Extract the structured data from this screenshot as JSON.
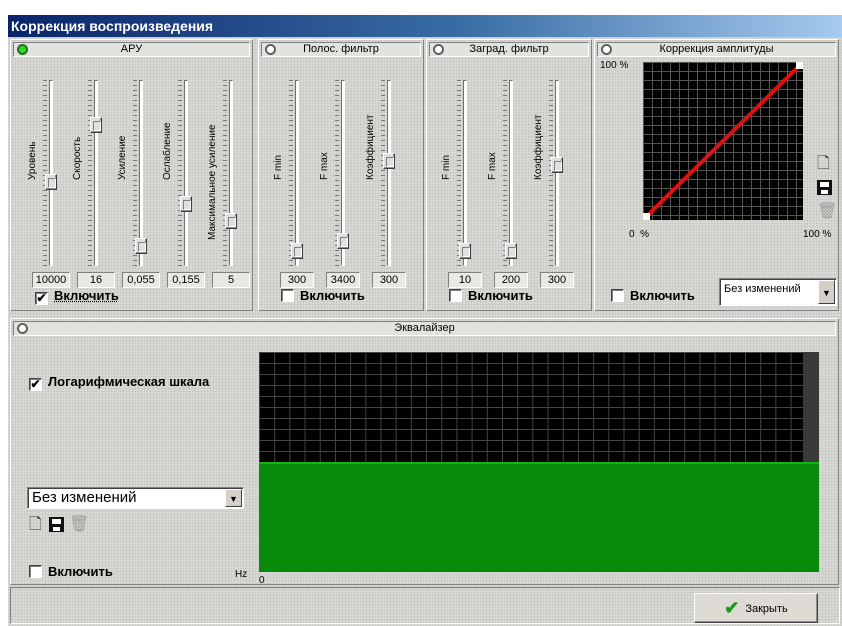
{
  "window": {
    "title": "Коррекция воспроизведения"
  },
  "agc": {
    "title": "АРУ",
    "status": "on",
    "sliders": [
      {
        "label": "Уровень",
        "value": "10000",
        "position": 0.55
      },
      {
        "label": "Скорость",
        "value": "16",
        "position": 0.22
      },
      {
        "label": "Усиление",
        "value": "0,055",
        "position": 0.93
      },
      {
        "label": "Ослабление",
        "value": "0,155",
        "position": 0.68
      },
      {
        "label": "Максимальное усиление",
        "value": "5",
        "position": 0.78
      }
    ],
    "enable_label": "Включить",
    "enabled": true
  },
  "bandpass": {
    "title": "Полос. фильтр",
    "status": "off",
    "sliders": [
      {
        "label": "F min",
        "value": "300",
        "position": 0.96
      },
      {
        "label": "F max",
        "value": "3400",
        "position": 0.9
      },
      {
        "label": "Коэффициент",
        "value": "300",
        "position": 0.43
      }
    ],
    "enable_label": "Включить",
    "enabled": false
  },
  "notch": {
    "title": "Заград. фильтр",
    "status": "off",
    "sliders": [
      {
        "label": "F min",
        "value": "10",
        "position": 0.96
      },
      {
        "label": "F max",
        "value": "200",
        "position": 0.96
      },
      {
        "label": "Коэффициент",
        "value": "300",
        "position": 0.45
      }
    ],
    "enable_label": "Включить",
    "enabled": false
  },
  "amplitude": {
    "title": "Коррекция амплитуды",
    "status": "off",
    "axis_top": "100 %",
    "axis_left": "0  %",
    "axis_right": "100 %",
    "line_color": "#e01010",
    "enable_label": "Включить",
    "enabled": false,
    "preset": "Без изменений",
    "icons": [
      "new-icon",
      "save-icon",
      "delete-icon"
    ]
  },
  "equalizer": {
    "title": "Эквалайзер",
    "status": "off",
    "log_scale_label": "Логарифмическая шкала",
    "log_scale": true,
    "preset": "Без изменений",
    "enable_label": "Включить",
    "enabled": false,
    "axis_unit": "Hz",
    "axis_zero": "0",
    "level": 0.5,
    "fill_color": "#0a8a0a",
    "icons": [
      "new-icon",
      "save-icon",
      "delete-icon"
    ]
  },
  "footer": {
    "close_label": "Закрыть"
  }
}
